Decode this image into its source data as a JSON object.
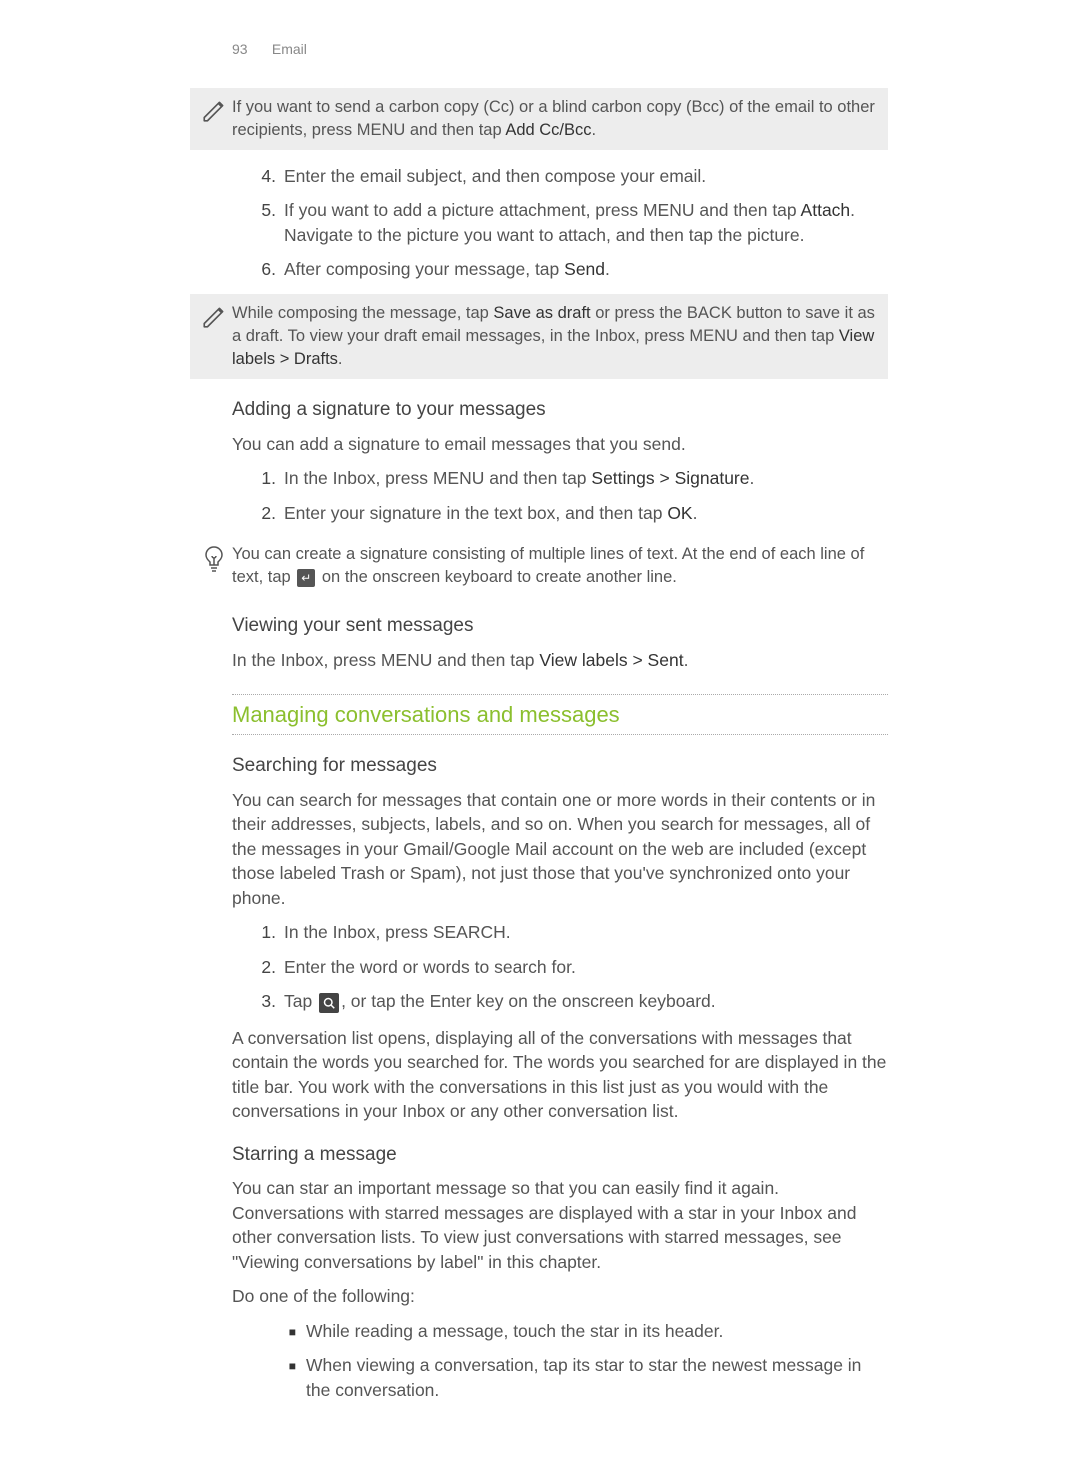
{
  "header": {
    "page_number": "93",
    "chapter": "Email"
  },
  "note1": {
    "runs": [
      {
        "t": "If you want to send a carbon copy (Cc) or a blind carbon copy (Bcc) of the email to other recipients, press MENU and then tap "
      },
      {
        "t": "Add Cc/Bcc",
        "s": true
      },
      {
        "t": "."
      }
    ]
  },
  "list1": [
    {
      "n": "4.",
      "runs": [
        {
          "t": "Enter the email subject, and then compose your email."
        }
      ]
    },
    {
      "n": "5.",
      "runs": [
        {
          "t": "If you want to add a picture attachment, press MENU and then tap "
        },
        {
          "t": "Attach",
          "s": true
        },
        {
          "t": ". Navigate to the picture you want to attach, and then tap the picture."
        }
      ]
    },
    {
      "n": "6.",
      "runs": [
        {
          "t": "After composing your message, tap "
        },
        {
          "t": "Send",
          "s": true
        },
        {
          "t": "."
        }
      ]
    }
  ],
  "note2": {
    "runs": [
      {
        "t": "While composing the message, tap "
      },
      {
        "t": "Save as draft",
        "s": true
      },
      {
        "t": " or press the BACK button to save it as a draft. To view your draft email messages, in the Inbox, press MENU and then tap "
      },
      {
        "t": "View labels > Drafts",
        "s": true
      },
      {
        "t": "."
      }
    ]
  },
  "h_signature": "Adding a signature to your messages",
  "p_signature": "You can add a signature to email messages that you send.",
  "list_sig": [
    {
      "n": "1.",
      "runs": [
        {
          "t": "In the Inbox, press MENU and then tap "
        },
        {
          "t": "Settings > Signature",
          "s": true
        },
        {
          "t": "."
        }
      ]
    },
    {
      "n": "2.",
      "runs": [
        {
          "t": "Enter your signature in the text box, and then tap "
        },
        {
          "t": "OK",
          "s": true
        },
        {
          "t": "."
        }
      ]
    }
  ],
  "tip1": {
    "pre": "You can create a signature consisting of multiple lines of text. At the end of each line of text, tap ",
    "key_glyph": "↵",
    "post": " on the onscreen keyboard to create another line."
  },
  "h_sent": "Viewing your sent messages",
  "p_sent": {
    "runs": [
      {
        "t": "In the Inbox, press MENU and then tap "
      },
      {
        "t": "View labels > Sent",
        "s": true
      },
      {
        "t": "."
      }
    ]
  },
  "section_title": "Managing conversations and messages",
  "h_search": "Searching for messages",
  "p_search_intro": "You can search for messages that contain one or more words in their contents or in their addresses, subjects, labels, and so on. When you search for messages, all of the messages in your Gmail/Google Mail account on the web are included (except those labeled Trash or Spam), not just those that you've synchronized onto your phone.",
  "list_search": [
    {
      "n": "1.",
      "runs": [
        {
          "t": "In the Inbox, press SEARCH."
        }
      ]
    },
    {
      "n": "2.",
      "runs": [
        {
          "t": "Enter the word or words to search for."
        }
      ]
    },
    {
      "n": "3.",
      "pre": "Tap ",
      "post": ", or tap the Enter key on the onscreen keyboard.",
      "search_icon": true
    }
  ],
  "p_search_result": "A conversation list opens, displaying all of the conversations with messages that contain the words you searched for. The words you searched for are displayed in the title bar. You work with the conversations in this list just as you would with the conversations in your Inbox or any other conversation list.",
  "h_star": "Starring a message",
  "p_star_intro": "You can star an important message so that you can easily find it again. Conversations with starred messages are displayed with a star in your Inbox and other conversation lists. To view just conversations with starred messages, see \"Viewing conversations by label\" in this chapter.",
  "p_do_one": "Do one of the following:",
  "bullets_star": [
    {
      "t": "While reading a message, touch the star in its header."
    },
    {
      "t": "When viewing a conversation, tap its star to star the newest message in the conversation."
    }
  ]
}
